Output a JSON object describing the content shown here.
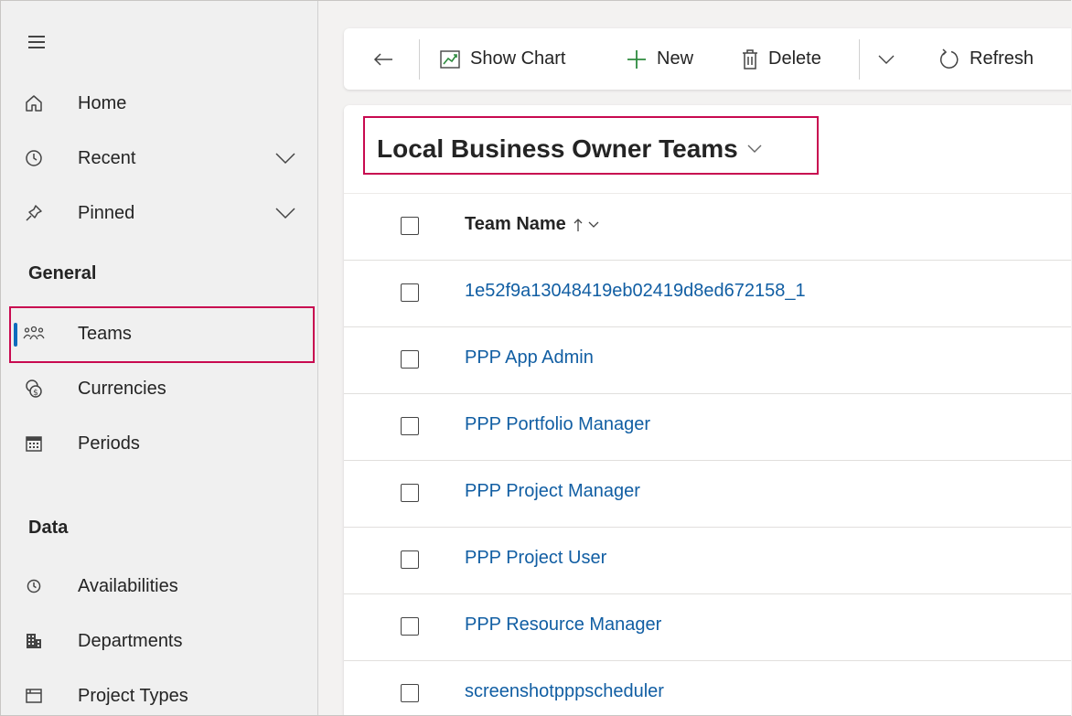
{
  "sidebar": {
    "items_top": [
      {
        "label": "Home",
        "icon": "home-icon"
      },
      {
        "label": "Recent",
        "icon": "clock-icon",
        "expandable": true
      },
      {
        "label": "Pinned",
        "icon": "pin-icon",
        "expandable": true
      }
    ],
    "section_general": "General",
    "items_general": [
      {
        "label": "Teams",
        "icon": "people-team-icon",
        "selected": true
      },
      {
        "label": "Currencies",
        "icon": "currency-icon"
      },
      {
        "label": "Periods",
        "icon": "calendar-icon"
      }
    ],
    "section_data": "Data",
    "items_data": [
      {
        "label": "Availabilities",
        "icon": "clock-icon"
      },
      {
        "label": "Departments",
        "icon": "building-icon"
      },
      {
        "label": "Project Types",
        "icon": "project-type-icon"
      }
    ]
  },
  "toolbar": {
    "show_chart": "Show Chart",
    "new": "New",
    "delete": "Delete",
    "refresh": "Refresh"
  },
  "view": {
    "title": "Local Business Owner Teams"
  },
  "grid": {
    "column_header": "Team Name",
    "rows": [
      "1e52f9a13048419eb02419d8ed672158_1",
      "PPP App Admin",
      "PPP Portfolio Manager",
      "PPP Project Manager",
      "PPP Project User",
      "PPP Resource Manager",
      "screenshotpppscheduler"
    ]
  },
  "colors": {
    "accent": "#0f6cbd",
    "link": "#115ea3",
    "highlight": "#c80a50",
    "new_icon": "#2e8b3f"
  }
}
